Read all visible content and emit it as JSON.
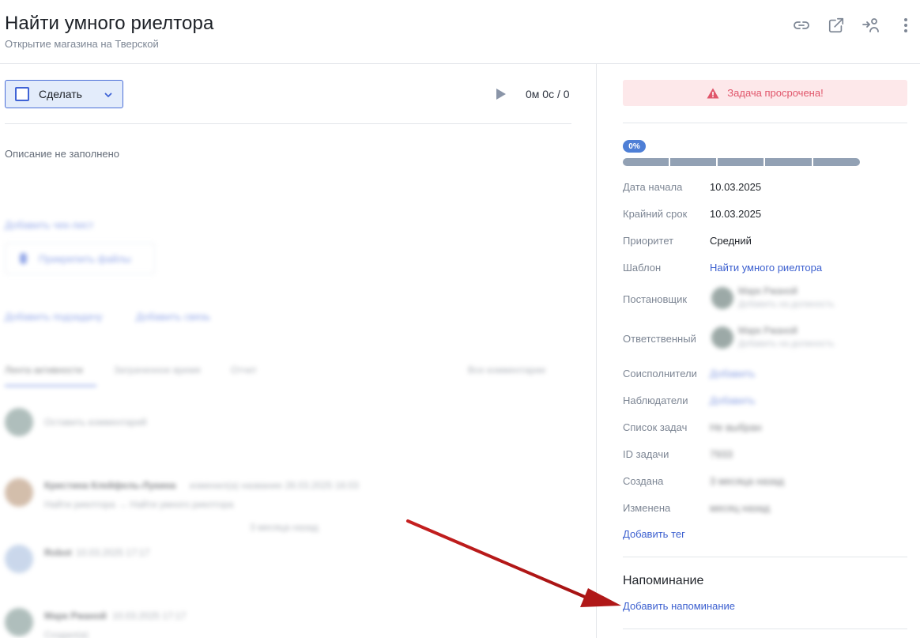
{
  "header": {
    "title": "Найти умного риелтора",
    "subtitle": "Открытие магазина на Тверской",
    "icons": [
      "link-icon",
      "open-external-icon",
      "delegate-user-icon",
      "more-vertical-icon"
    ]
  },
  "left": {
    "do_button_label": "Сделать",
    "timer": "0м 0с / 0",
    "description_placeholder": "Описание не заполнено",
    "blurred": {
      "add_checklist": "Добавить чек-лист",
      "attach_files": "Прикрепить файлы",
      "add_subtask": "Добавить подзадачу",
      "add_link": "Добавить связь",
      "tab_activity": "Лента активности",
      "tab_time": "Затраченное время",
      "tab_report": "Отчет",
      "filter_comments": "Все комментарии",
      "leave_comment": "Оставить комментарий",
      "comment1_author": "Кристина Клейфель-Лукина",
      "comment1_meta": "изменил(а) название 28.03.2025 16:03",
      "comment1_text": "Найти риелтора → Найти умного риелтора",
      "divider_text": "3 месяца назад",
      "comment2_author": "Robot",
      "comment2_meta": "10.03.2025 17:17",
      "comment3_author": "Марк Ржаной",
      "comment3_meta": "10.03.2025 17:17",
      "comment3_text": "Создал(а)"
    }
  },
  "right": {
    "overdue_text": "Задача просрочена!",
    "progress_label": "0%",
    "progress_value": 0,
    "fields": {
      "start_label": "Дата начала",
      "start_value": "10.03.2025",
      "deadline_label": "Крайний срок",
      "deadline_value": "10.03.2025",
      "priority_label": "Приоритет",
      "priority_value": "Средний",
      "template_label": "Шаблон",
      "template_value": "Найти умного риелтора",
      "author_label": "Постановщик",
      "author_name": "Марк Ржаной",
      "author_role": "Добавить на должность",
      "responsible_label": "Ответственный",
      "responsible_name": "Марк Ржаной",
      "responsible_role": "Добавить на должность",
      "coexecutors_label": "Соисполнители",
      "coexecutors_value": "Добавить",
      "observers_label": "Наблюдатели",
      "observers_value": "Добавить",
      "tasklist_label": "Список задач",
      "tasklist_value": "Не выбран",
      "id_label": "ID задачи",
      "id_value": "7933",
      "created_label": "Создана",
      "created_value": "3 месяца назад",
      "modified_label": "Изменена",
      "modified_value": "месяц назад"
    },
    "add_tag": "Добавить тег",
    "reminder_title": "Напоминание",
    "add_reminder": "Добавить напоминание"
  },
  "colors": {
    "accent": "#3b5fcf",
    "overdue_bg": "#fde8ea",
    "overdue_text": "#e0556a",
    "arrow": "#b01818"
  }
}
